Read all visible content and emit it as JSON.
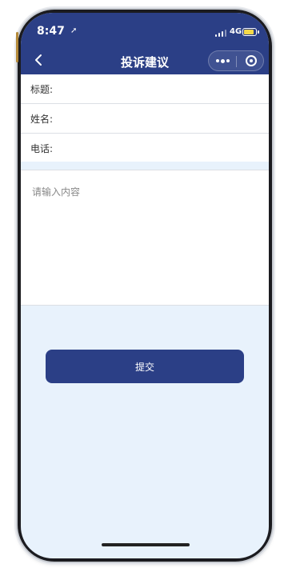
{
  "status_bar": {
    "time": "8:47",
    "network": "4G"
  },
  "nav": {
    "title": "投诉建议",
    "back_icon": "chevron-left-icon",
    "more_icon": "more-dots-icon",
    "close_icon": "target-circle-icon"
  },
  "form": {
    "fields": [
      {
        "label": "标题:",
        "value": ""
      },
      {
        "label": "姓名:",
        "value": ""
      },
      {
        "label": "电话:",
        "value": ""
      }
    ],
    "content": {
      "placeholder": "请输入内容",
      "value": ""
    }
  },
  "submit_label": "提交",
  "colors": {
    "primary": "#2b3f86",
    "page_bg": "#e8f2fc",
    "battery": "#f3d84a"
  }
}
